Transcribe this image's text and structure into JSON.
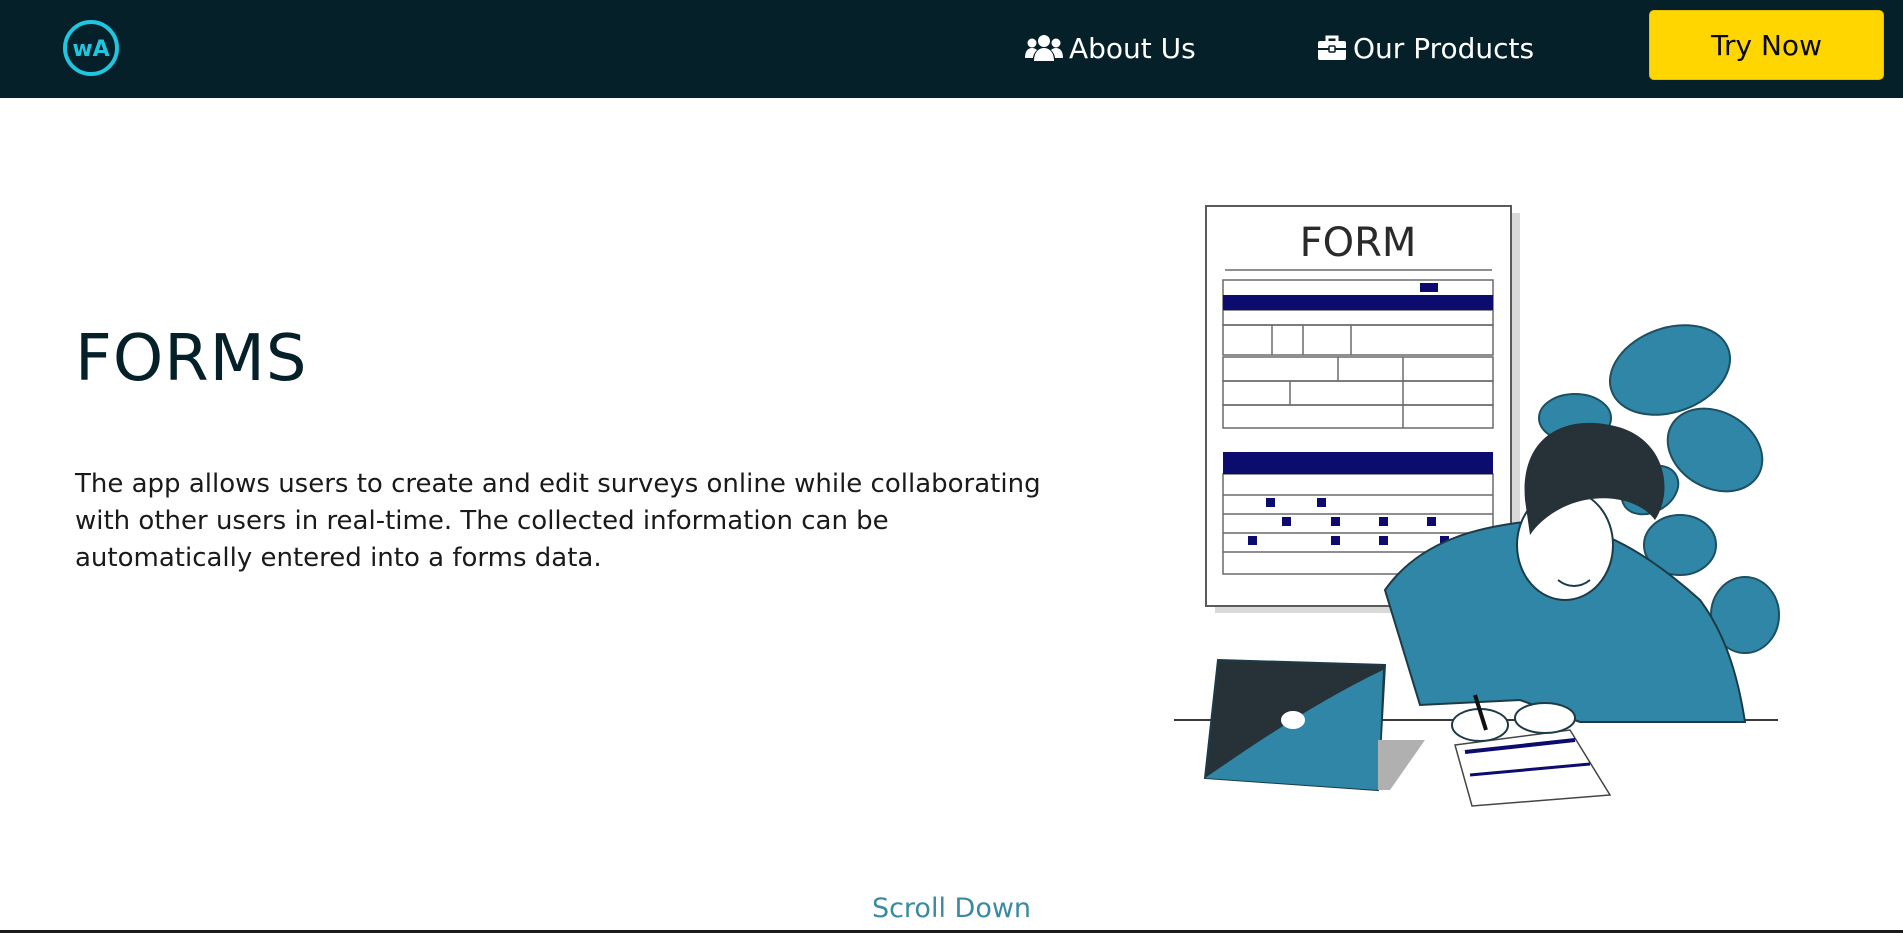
{
  "nav": {
    "logo_text": "wA",
    "about_label": "About Us",
    "products_label": "Our Products",
    "try_label": "Try Now"
  },
  "hero": {
    "title": "FORMS",
    "description": "The app allows users to create and edit surveys online while collaborating with other users in real-time. The collected information can be automatically entered into a forms data.",
    "illustration_form_label": "FORM"
  },
  "footer": {
    "scroll_label": "Scroll Down"
  },
  "colors": {
    "nav_bg": "#052029",
    "accent_yellow": "#ffd600",
    "logo_cyan": "#1fc6e0",
    "teal": "#2f86a6",
    "form_navy": "#0c0c6e"
  },
  "icons": [
    "users-icon",
    "briefcase-icon"
  ]
}
